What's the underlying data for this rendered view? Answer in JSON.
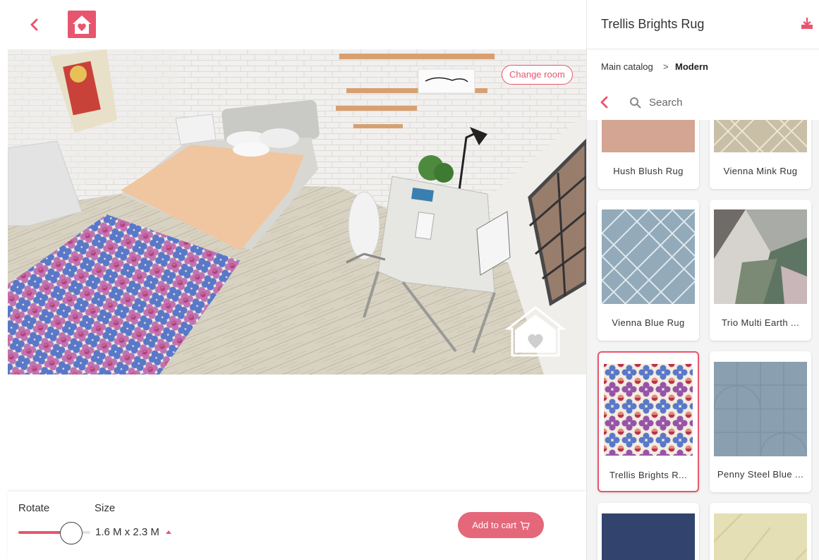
{
  "header": {
    "back_icon": "chevron-left-icon",
    "logo_icon": "house-heart-logo-icon",
    "accent_color": "#e8566e"
  },
  "scene": {
    "change_room_label": "Change room"
  },
  "controls": {
    "rotate_label": "Rotate",
    "size_label": "Size",
    "size_value": "1.6 M x 2.3 M",
    "rotate_value_fraction": 0.71,
    "add_to_cart_label": "Add to cart"
  },
  "panel": {
    "title": "Trellis Brights Rug",
    "download_icon": "download-icon",
    "breadcrumb": {
      "root": "Main catalog",
      "separator": ">",
      "current": "Modern"
    },
    "search": {
      "placeholder": "Search"
    },
    "products": [
      {
        "name": "Hush Blush Rug",
        "selected": false
      },
      {
        "name": "Vienna Mink Rug",
        "selected": false
      },
      {
        "name": "Vienna Blue Rug",
        "selected": false
      },
      {
        "name": "Trio Multi Earth ...",
        "selected": false
      },
      {
        "name": "Trellis Brights R...",
        "selected": true
      },
      {
        "name": "Penny Steel Blue ...",
        "selected": false
      },
      {
        "name": "",
        "selected": false
      },
      {
        "name": "",
        "selected": false
      }
    ]
  }
}
